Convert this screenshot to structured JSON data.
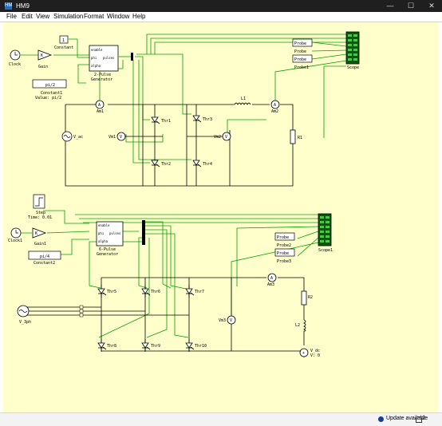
{
  "window": {
    "title": "HM9",
    "app_icon": "HM"
  },
  "window_controls": {
    "minimize": "—",
    "maximize": "☐",
    "close": "✕"
  },
  "menu": [
    "File",
    "Edit",
    "View",
    "Simulation",
    "Format",
    "Window",
    "Help"
  ],
  "status": {
    "update": "Update available",
    "count": "2"
  },
  "colors": {
    "canvas": "#ffffcc",
    "wire": "#00a000",
    "block": "#000000",
    "scope": "#00cc00"
  },
  "diagram": {
    "top": {
      "clock": "Clock",
      "gain_sym": "K",
      "gain": "Gain",
      "constant_val": "1",
      "constant": "Constant",
      "constant1_val": "pi/2",
      "constant1": "Constant1",
      "constant1_value": "Value: pi/2",
      "pulse_title": "2-Pulse\nGenerator",
      "port_enable": "enable",
      "port_phi": "phi",
      "port_alpha": "alpha",
      "port_pulses": "pulses",
      "am1": "Am1",
      "am2": "Am2",
      "vm1": "Vm1",
      "vm2": "Vm2",
      "v_ac": "V_ac",
      "thr1": "Thr1",
      "thr2": "Thr2",
      "thr3": "Thr3",
      "thr4": "Thr4",
      "l1": "L1",
      "r1": "R1",
      "probe": "Probe",
      "probe_b": "Probe",
      "probe_c": "Probe",
      "probe1": "Probe1",
      "scope": "Scope"
    },
    "bottom": {
      "step_time": "Step\nTime: 0.01",
      "clock1": "Clock1",
      "gain_sym": "K",
      "gain1": "Gain1",
      "constant2_val": "pi/4",
      "constant2": "Constant2",
      "pulse_title": "6-Pulse\nGenerator",
      "port_enable": "enable",
      "port_phi": "phi",
      "port_alpha": "alpha",
      "port_pulses": "pulses",
      "v_3ph": "V_3ph",
      "thr5": "Thr5",
      "thr6": "Thr6",
      "thr7": "Thr7",
      "thr8": "Thr8",
      "thr9": "Thr9",
      "thr10": "Thr10",
      "am3": "Am3",
      "vm3": "Vm3",
      "r2": "R2",
      "l2": "L2",
      "v_dc": "V_dc",
      "v_dc_val": "V: 0",
      "probe": "Probe",
      "probe2": "Probe2",
      "probe_b": "Probe",
      "probe3": "Probe3",
      "scope1": "Scope1"
    }
  }
}
